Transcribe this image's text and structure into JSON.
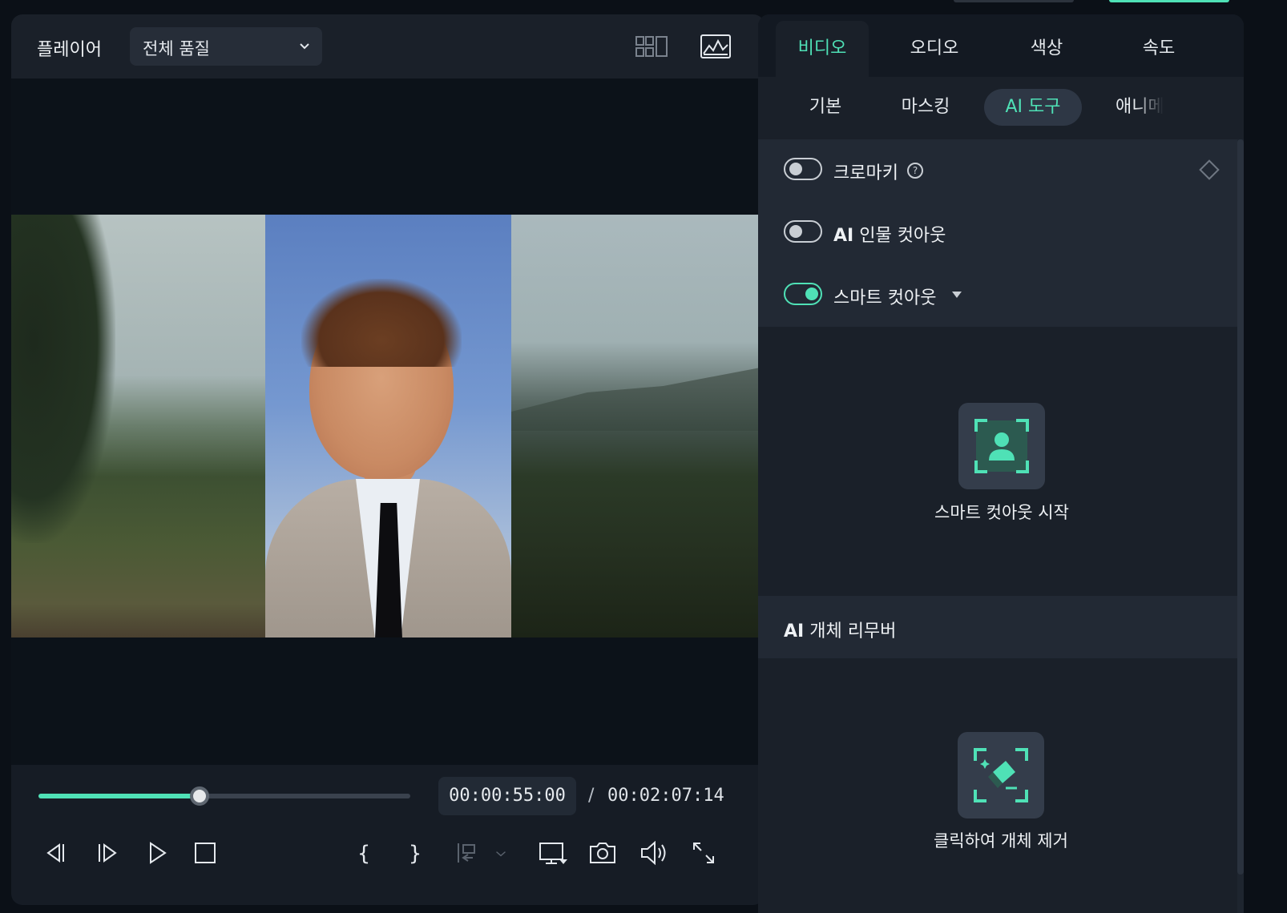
{
  "player": {
    "title": "플레이어",
    "quality": {
      "selected": "전체 품질"
    },
    "icons": [
      "grid-layout-icon",
      "video-scope-icon"
    ]
  },
  "transport": {
    "progress_fraction": 0.433,
    "current_time": "00:00:55:00",
    "separator": "/",
    "total_time": "00:02:07:14",
    "buttons": [
      "previous-frame-icon",
      "next-frame-icon",
      "play-icon",
      "stop-icon",
      "mark-in-icon",
      "mark-out-icon",
      "insert-marker-icon",
      "marker-dropdown-icon",
      "display-settings-icon",
      "snapshot-icon",
      "volume-icon",
      "fullscreen-icon"
    ]
  },
  "props": {
    "tabs": [
      {
        "label": "비디오",
        "active": true
      },
      {
        "label": "오디오",
        "active": false
      },
      {
        "label": "색상",
        "active": false
      },
      {
        "label": "속도",
        "active": false
      }
    ],
    "subtabs": [
      {
        "label": "기본",
        "active": false
      },
      {
        "label": "마스킹",
        "active": false
      },
      {
        "label": "AI 도구",
        "active": true
      },
      {
        "label": "애니메이션",
        "active": false
      }
    ],
    "toggles": [
      {
        "label": "크로마키",
        "on": false,
        "has_help": true,
        "has_keyframe": true
      },
      {
        "label_prefix": "AI",
        "label": "인물 컷아웃",
        "on": false
      },
      {
        "label": "스마트 컷아웃",
        "on": true,
        "has_dropdown": true
      }
    ],
    "smart_cutout": {
      "button_label": "스마트 컷아웃 시작",
      "icon": "person-cutout-icon"
    },
    "object_remover": {
      "section_prefix": "AI",
      "section_title": "개체 리무버",
      "button_label": "클릭하여 개체 제거",
      "icon": "eraser-select-icon"
    }
  },
  "colors": {
    "accent": "#4fe1b6",
    "panel": "#1a2029",
    "background": "#0b1017"
  }
}
